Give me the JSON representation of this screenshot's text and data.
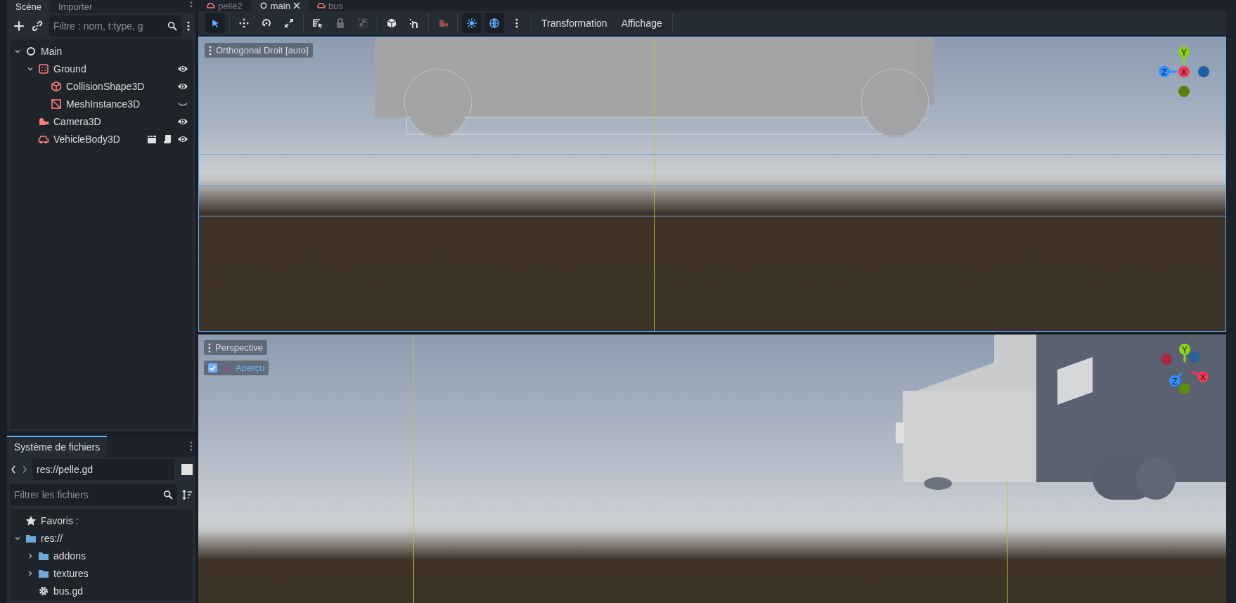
{
  "scene_dock": {
    "tabs": [
      {
        "label": "Scène",
        "selected": true
      },
      {
        "label": "Importer",
        "selected": false
      }
    ],
    "filter": {
      "placeholder": "Filtre : nom, t:type, g"
    },
    "tree": [
      {
        "name": "Main",
        "kind": "node",
        "expanded": true,
        "children": [
          {
            "name": "Ground",
            "kind": "static",
            "expanded": true,
            "visible": true,
            "children": [
              {
                "name": "CollisionShape3D",
                "kind": "collision",
                "visible": true
              },
              {
                "name": "MeshInstance3D",
                "kind": "mesh",
                "visible": false
              }
            ]
          },
          {
            "name": "Camera3D",
            "kind": "camera",
            "visible": true
          },
          {
            "name": "VehicleBody3D",
            "kind": "vehicle",
            "visible": true,
            "scene_instance": true,
            "script": true
          }
        ]
      }
    ]
  },
  "editor_tabs": [
    {
      "label": "pelle2",
      "kind": "vehicle",
      "selected": false
    },
    {
      "label": "main",
      "kind": "node",
      "selected": true
    },
    {
      "label": "bus",
      "kind": "vehicle",
      "selected": false
    }
  ],
  "toolbar": {
    "tool_groups": [
      [
        {
          "kind": "select",
          "selected": true
        }
      ],
      [
        {
          "kind": "move",
          "selected": false
        },
        {
          "kind": "rotate",
          "selected": false
        },
        {
          "kind": "scale",
          "selected": false
        }
      ],
      [
        {
          "kind": "list-select",
          "selected": false
        },
        {
          "kind": "lock",
          "selected": false
        },
        {
          "kind": "group",
          "selected": false
        }
      ],
      [
        {
          "kind": "local",
          "selected": false
        },
        {
          "kind": "snap",
          "selected": false
        }
      ],
      [
        {
          "kind": "camera",
          "selected": false
        }
      ],
      [
        {
          "kind": "sun",
          "selected": true
        },
        {
          "kind": "environment",
          "selected": true
        },
        {
          "kind": "more",
          "selected": false
        }
      ]
    ],
    "menus": [
      "Transformation",
      "Affichage"
    ]
  },
  "viewports": [
    {
      "kind": "ortho",
      "label": "Orthogonal Droit [auto]",
      "gizmo": [
        {
          "label": "Y",
          "color": "#8ad21e"
        },
        {
          "label": "Z",
          "color": "#2f8fff"
        },
        {
          "label": "X",
          "color": "#f03a57"
        },
        {
          "color": "#1e5fa8"
        },
        {
          "color": "#5a7f10"
        }
      ]
    },
    {
      "kind": "perspective",
      "label": "Perspective",
      "preview": {
        "label": "Aperçu",
        "checked": true
      },
      "gizmo": [
        {
          "label": "Y",
          "color": "#8ad21e"
        },
        {
          "color": "#a52a40"
        },
        {
          "color": "#2b5f9e"
        },
        {
          "label": "Z",
          "color": "#2f8fff"
        },
        {
          "label": "X",
          "color": "#f03a57"
        },
        {
          "color": "#5a8f10"
        }
      ]
    }
  ],
  "filesystem": {
    "tab": "Système de fichiers",
    "path": "res://pelle.gd",
    "filter": {
      "placeholder": "Filtrer les fichiers"
    },
    "favorites": "Favoris :",
    "tree": [
      {
        "name": "res://",
        "kind": "folder",
        "expanded": true,
        "children": [
          {
            "name": "addons",
            "kind": "folder",
            "expanded": false
          },
          {
            "name": "textures",
            "kind": "folder",
            "expanded": false
          },
          {
            "name": "bus.gd",
            "kind": "script"
          }
        ]
      }
    ]
  }
}
